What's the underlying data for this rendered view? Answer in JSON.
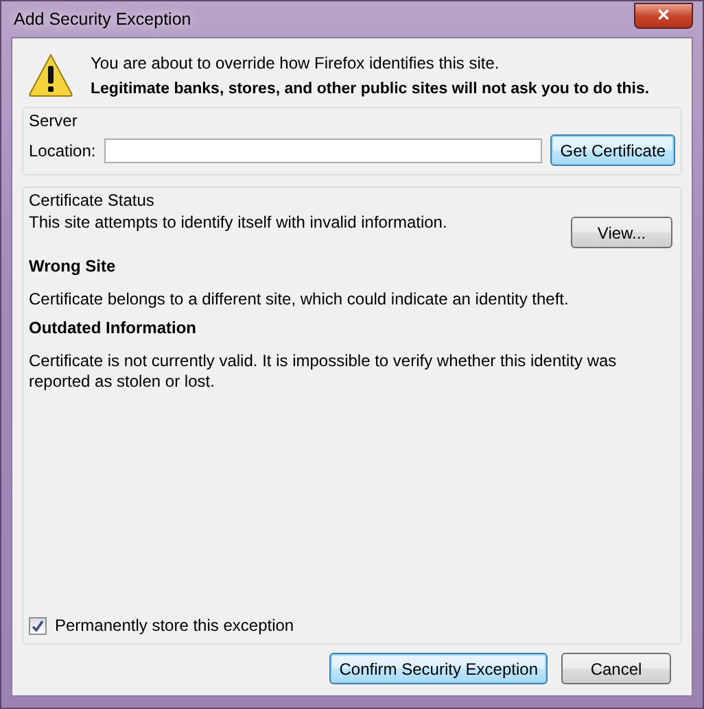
{
  "window": {
    "title": "Add Security Exception",
    "close": "✕"
  },
  "warning": {
    "lines": [
      {
        "text": "You are about to override how Firefox identifies this site.",
        "bold": false
      },
      {
        "text": "Legitimate banks, stores, and other public sites will not ask you to do this.",
        "bold": true
      }
    ]
  },
  "server": {
    "title": "Server",
    "location_label": "Location:",
    "get_certificate": "Get Certificate"
  },
  "certificate_status": {
    "title": "Certificate Status",
    "summary": "This site attempts to identify itself with invalid information.",
    "view": "View...",
    "problems": [
      {
        "heading": "Wrong Site",
        "text": "Certificate belongs to a different site, which could indicate an identity theft."
      },
      {
        "heading": "Outdated Information",
        "text": "Certificate is not currently valid. It is impossible to verify whether this identity was reported as stolen or lost."
      }
    ],
    "permanent": {
      "label": "Permanently store this exception",
      "checked": true
    }
  },
  "buttons": [
    {
      "label": "Confirm Security Exception",
      "default": true
    },
    {
      "label": "Cancel",
      "default": false
    }
  ]
}
